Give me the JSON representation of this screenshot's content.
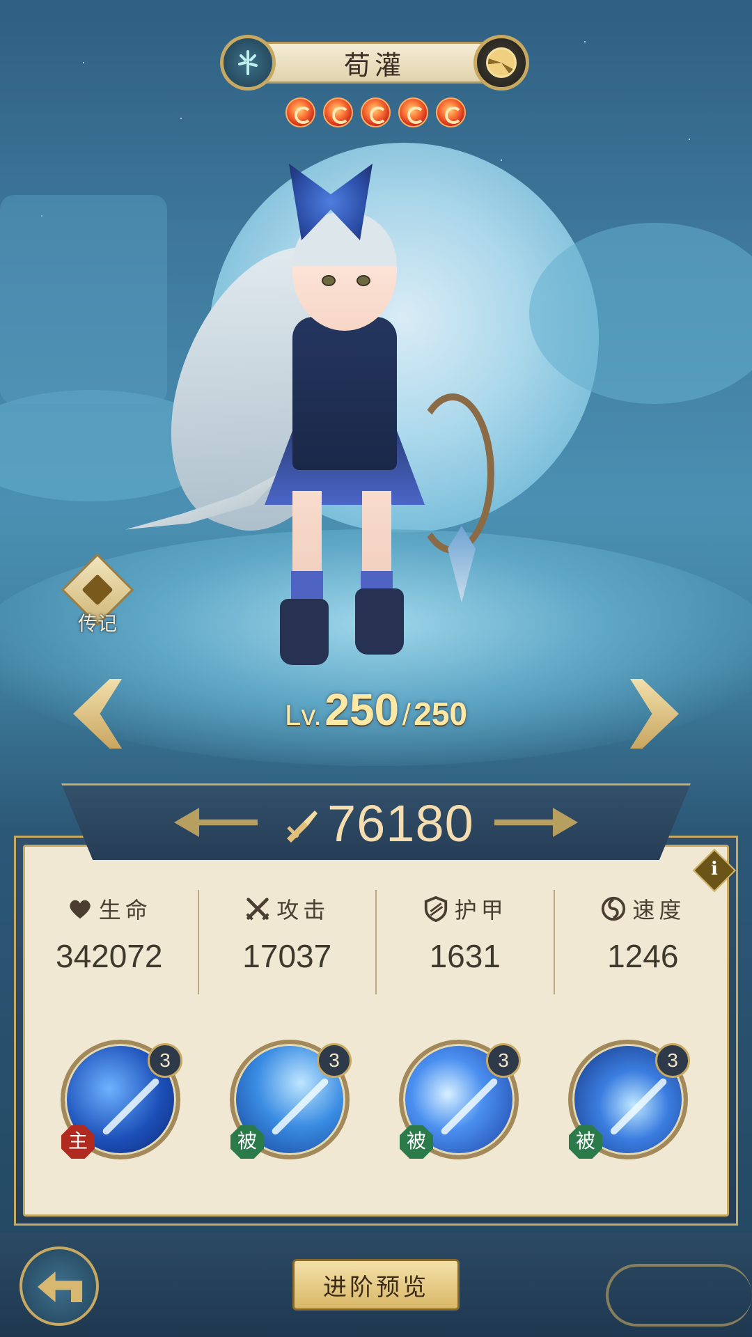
{
  "hero": {
    "name": "荀灌",
    "stars": 5,
    "level_prefix": "Lv.",
    "level_current": "250",
    "level_separator": "/",
    "level_max": "250",
    "power": "76180"
  },
  "legend_button": {
    "label": "传记"
  },
  "stats": [
    {
      "key": "hp",
      "label": "生命",
      "value": "342072",
      "icon": "heart-icon"
    },
    {
      "key": "atk",
      "label": "攻击",
      "value": "17037",
      "icon": "crossed-swords-icon"
    },
    {
      "key": "armor",
      "label": "护甲",
      "value": "1631",
      "icon": "shield-icon"
    },
    {
      "key": "speed",
      "label": "速度",
      "value": "1246",
      "icon": "swirl-icon"
    }
  ],
  "skills": [
    {
      "level": "3",
      "type": "主"
    },
    {
      "level": "3",
      "type": "被"
    },
    {
      "level": "3",
      "type": "被"
    },
    {
      "level": "3",
      "type": "被"
    }
  ],
  "info_button": {
    "label": "i"
  },
  "advance_button": {
    "label": "进阶预览"
  },
  "colors": {
    "gold": "#c7a961",
    "panel": "#f0e8d2",
    "active_skill": "#b02a20",
    "passive_skill": "#2a7a4a"
  }
}
